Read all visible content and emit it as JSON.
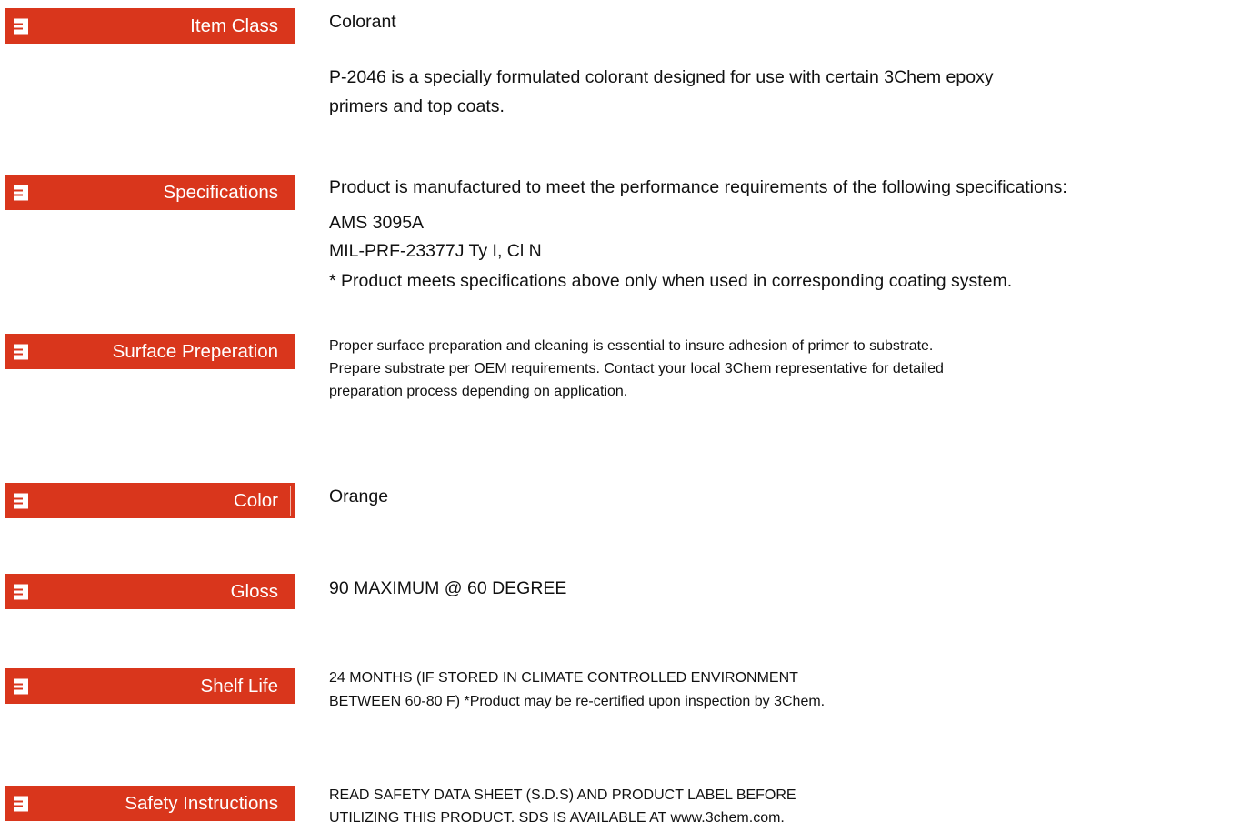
{
  "sections": [
    {
      "label": "Item Class",
      "value": "Colorant",
      "description": [
        "P-2046 is a specially formulated colorant designed for use with certain 3Chem epoxy",
        "primers and top coats."
      ]
    },
    {
      "label": "Specifications",
      "intro": "Product is manufactured to meet the performance requirements of the following specifications:",
      "items": [
        "AMS 3095A",
        "MIL-PRF-23377J Ty I, Cl N"
      ],
      "note": "* Product meets specifications above only when used in corresponding coating system."
    },
    {
      "label": "Surface Preperation",
      "lines": [
        "Proper surface preparation and cleaning is essential to insure adhesion of primer to substrate.",
        "Prepare substrate per OEM requirements. Contact your local 3Chem representative for detailed",
        "preparation process depending on application."
      ]
    },
    {
      "label": "Color",
      "value": "Orange"
    },
    {
      "label": "Gloss",
      "value": "90 MAXIMUM @ 60 DEGREE"
    },
    {
      "label": "Shelf Life",
      "lines": [
        "24 MONTHS (IF STORED IN CLIMATE CONTROLLED ENVIRONMENT",
        "BETWEEN 60-80 F)  *Product may be re-certified upon inspection by 3Chem."
      ]
    },
    {
      "label": "Safety Instructions",
      "lines": [
        "READ SAFETY DATA SHEET (S.D.S) AND PRODUCT LABEL BEFORE",
        "UTILIZING THIS PRODUCT. SDS IS AVAILABLE AT www.3chem.com."
      ]
    }
  ],
  "colors": {
    "badge_background": "#d9361c",
    "badge_text": "#ffffff",
    "body_text": "#111111"
  },
  "icons": {
    "badge_icon": "list-icon"
  }
}
